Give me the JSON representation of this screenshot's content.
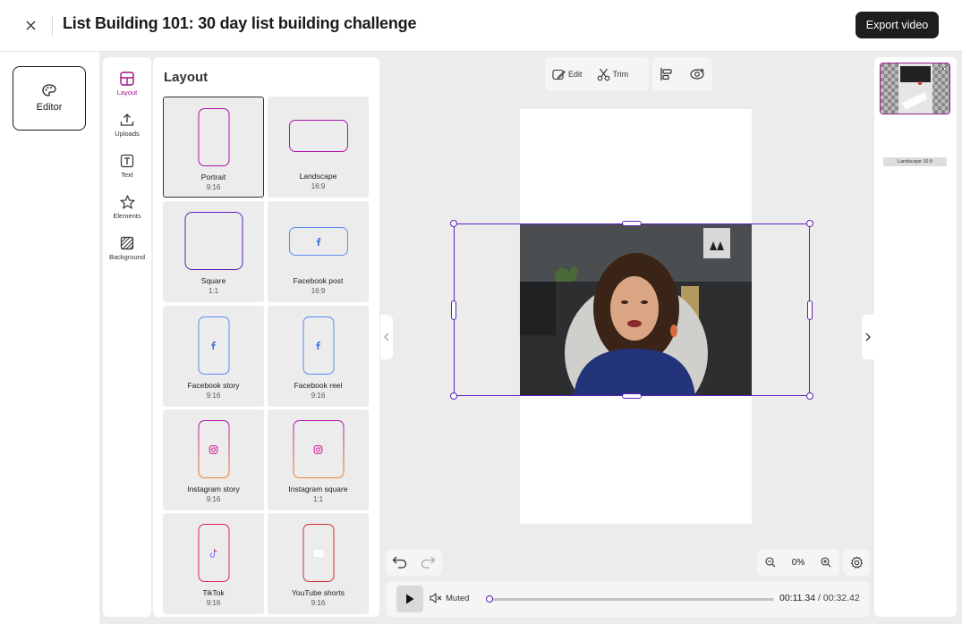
{
  "header": {
    "title": "List Building 101: 30 day list building challenge",
    "export_label": "Export video"
  },
  "editor_tab": {
    "label": "Editor",
    "icon": "palette-icon"
  },
  "rail": {
    "items": [
      {
        "label": "Layout",
        "icon": "layout-icon",
        "active": true
      },
      {
        "label": "Uploads",
        "icon": "upload-icon"
      },
      {
        "label": "Text",
        "icon": "text-icon"
      },
      {
        "label": "Elements",
        "icon": "star-icon"
      },
      {
        "label": "Background",
        "icon": "background-icon"
      }
    ]
  },
  "layout_panel": {
    "title": "Layout",
    "options": [
      {
        "label": "Portrait",
        "ratio": "9:16",
        "selected": true,
        "color": "#b012b0"
      },
      {
        "label": "Landscape",
        "ratio": "16:9",
        "color": "#b012b0"
      },
      {
        "label": "Square",
        "ratio": "1:1",
        "color": "#5b21b6"
      },
      {
        "label": "Facebook post",
        "ratio": "16:9",
        "color": "#3b82f6"
      },
      {
        "label": "Facebook story",
        "ratio": "9:16",
        "color": "#3b82f6"
      },
      {
        "label": "Facebook reel",
        "ratio": "9:16",
        "color": "#3b82f6"
      },
      {
        "label": "Instagram story",
        "ratio": "9:16",
        "color": "#e1306c"
      },
      {
        "label": "Instagram square",
        "ratio": "1:1",
        "color": "#e1306c"
      },
      {
        "label": "TikTok",
        "ratio": "9:16",
        "color": "#e0245e"
      },
      {
        "label": "YouTube shorts",
        "ratio": "9:16",
        "color": "#d32f2f"
      }
    ]
  },
  "toolbar": {
    "edit_label": "Edit",
    "trim_label": "Trim"
  },
  "zoom": {
    "value": "0%"
  },
  "playback": {
    "mute_label": "Muted",
    "current_time": "00:11.34",
    "separator": " / ",
    "duration": "00:32.42",
    "progress": 0.0
  },
  "right_panel": {
    "thumbnail_label": "Landscape 16:9"
  },
  "colors": {
    "selection": "#5b21b6",
    "accent": "#a0108e",
    "workspace": "#ececec"
  }
}
